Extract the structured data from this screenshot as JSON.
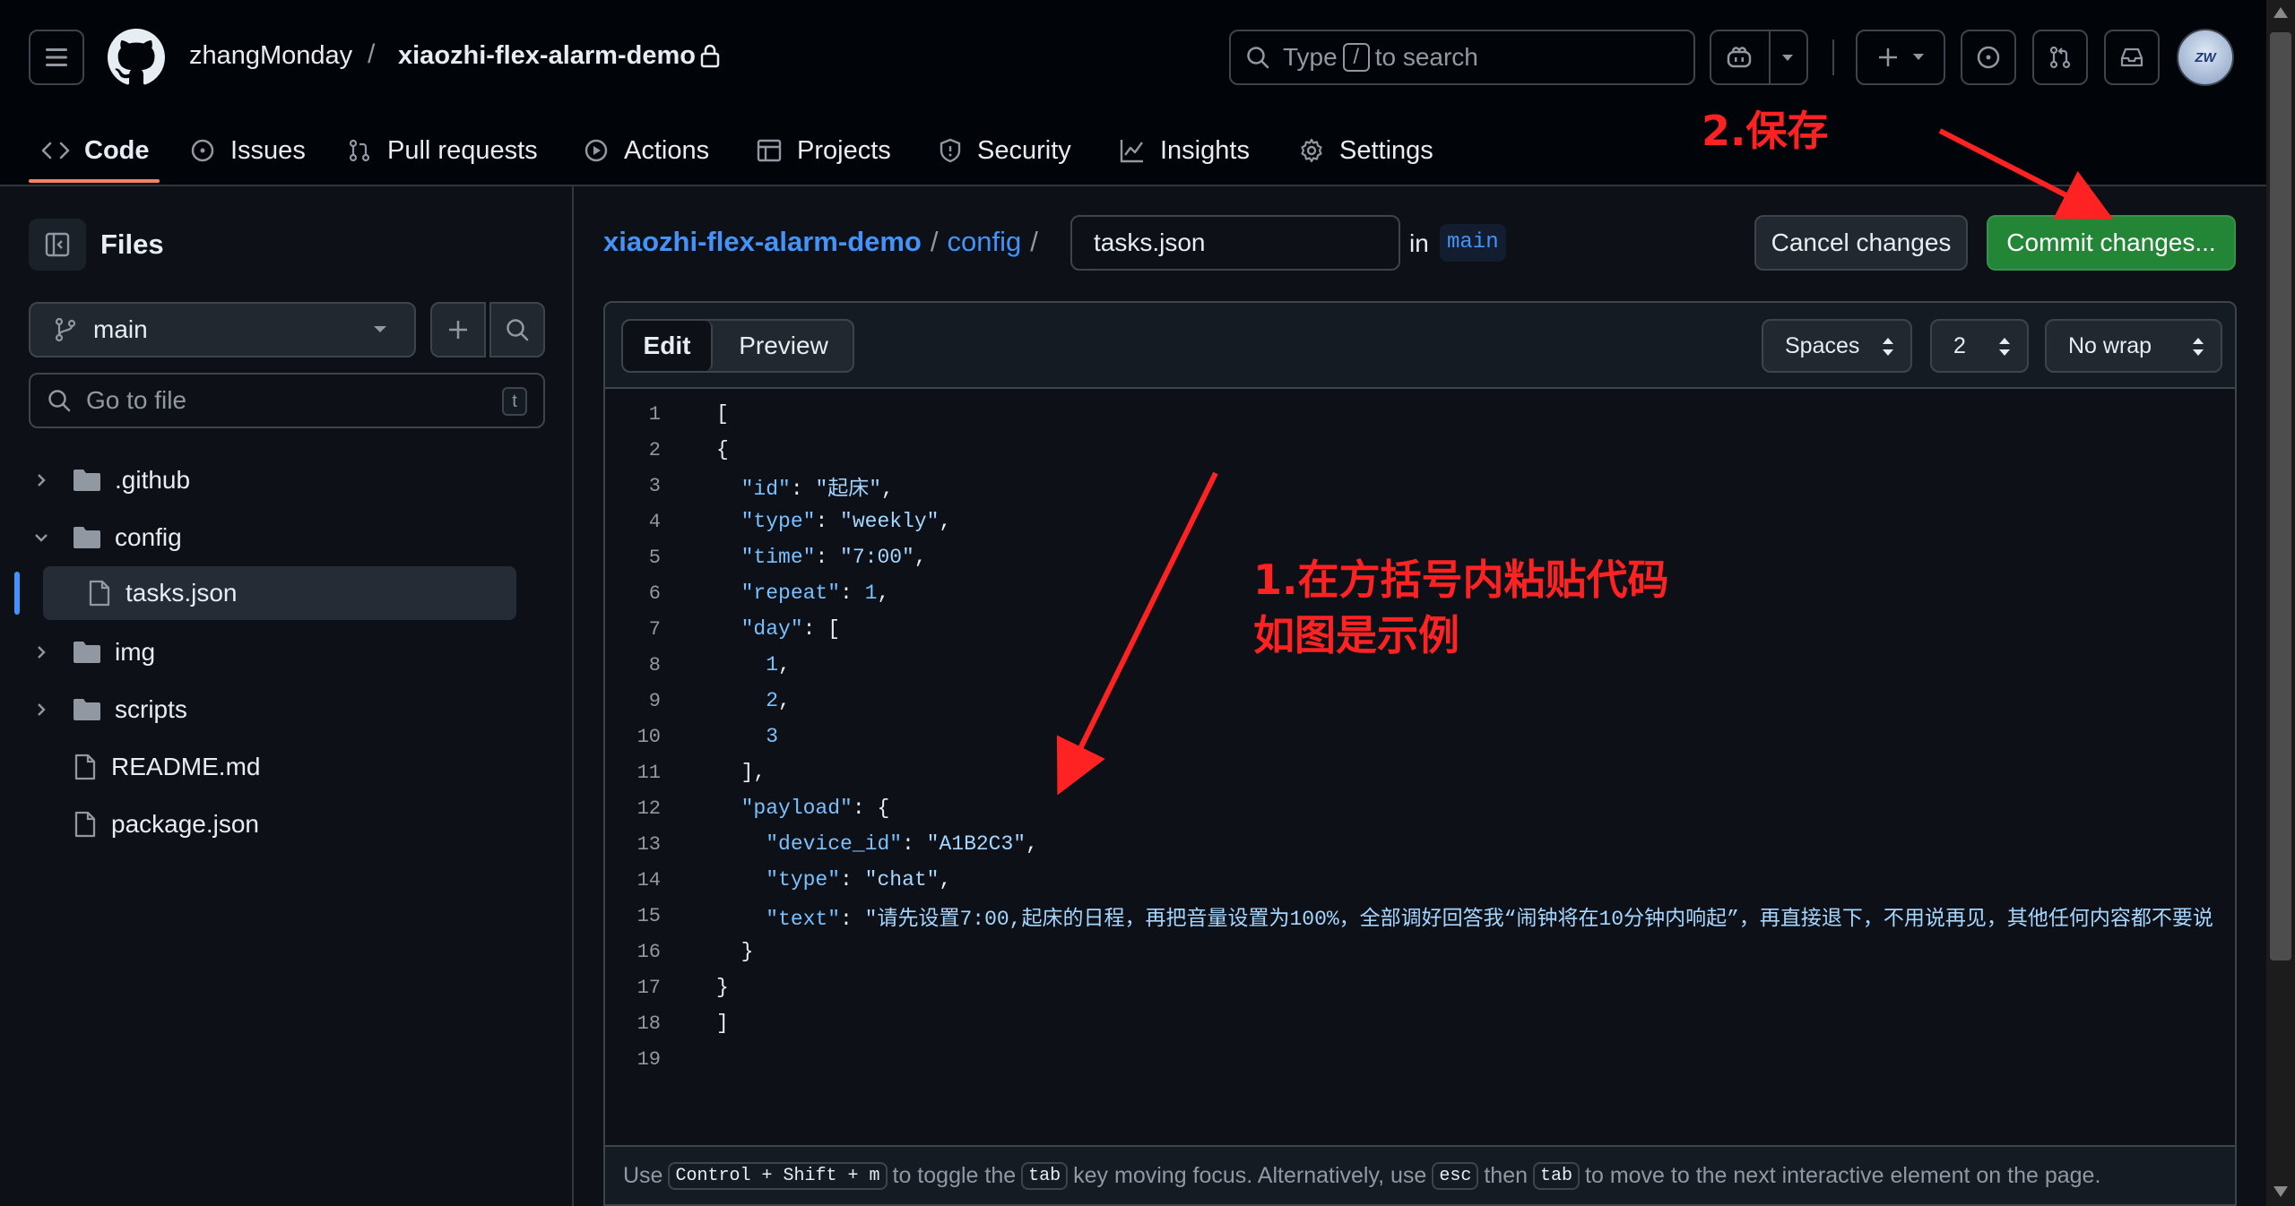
{
  "header": {
    "owner": "zhangMonday",
    "separator": "/",
    "repo": "xiaozhi-flex-alarm-demo",
    "search": {
      "prefix": "Type",
      "key": "/",
      "suffix": "to search"
    },
    "avatar_text": "ZW"
  },
  "tabs": [
    {
      "label": "Code",
      "icon": "code-icon"
    },
    {
      "label": "Issues",
      "icon": "issue-icon"
    },
    {
      "label": "Pull requests",
      "icon": "pull-request-icon"
    },
    {
      "label": "Actions",
      "icon": "play-icon"
    },
    {
      "label": "Projects",
      "icon": "table-icon"
    },
    {
      "label": "Security",
      "icon": "shield-icon"
    },
    {
      "label": "Insights",
      "icon": "graph-icon"
    },
    {
      "label": "Settings",
      "icon": "gear-icon"
    }
  ],
  "sidebar": {
    "title": "Files",
    "branch": "main",
    "goto_placeholder": "Go to file",
    "goto_kbd": "t",
    "tree": [
      {
        "name": ".github",
        "type": "folder",
        "expanded": false
      },
      {
        "name": "config",
        "type": "folder",
        "expanded": true
      },
      {
        "name": "tasks.json",
        "type": "file",
        "selected": true
      },
      {
        "name": "img",
        "type": "folder",
        "expanded": false
      },
      {
        "name": "scripts",
        "type": "folder",
        "expanded": false
      },
      {
        "name": "README.md",
        "type": "file"
      },
      {
        "name": "package.json",
        "type": "file"
      }
    ]
  },
  "breadcrumb": {
    "repo": "xiaozhi-flex-alarm-demo",
    "sep": "/",
    "folder": "config",
    "filename": "tasks.json",
    "in_label": "in",
    "branch": "main"
  },
  "actions": {
    "cancel": "Cancel changes",
    "commit": "Commit changes..."
  },
  "editor": {
    "edit_tab": "Edit",
    "preview_tab": "Preview",
    "indent_mode": "Spaces",
    "indent_size": "2",
    "wrap_mode": "No wrap",
    "lines": [
      "[",
      "{",
      "  \"id\": \"起床\",",
      "  \"type\": \"weekly\",",
      "  \"time\": \"7:00\",",
      "  \"repeat\": 1,",
      "  \"day\": [",
      "    1,",
      "    2,",
      "    3",
      "  ],",
      "  \"payload\": {",
      "    \"device_id\": \"A1B2C3\",",
      "    \"type\": \"chat\",",
      "    \"text\": \"请先设置7:00,起床的日程，再把音量设置为100%，全部调好回答我“闹钟将在10分钟内响起”，再直接退下，不用说再见，其他任何内容都不要说",
      "  }",
      "}",
      "]",
      ""
    ],
    "footer": {
      "t1": "Use",
      "k1": "Control + Shift + m",
      "t2": "to toggle the",
      "k2": "tab",
      "t3": "key moving focus. Alternatively, use",
      "k3": "esc",
      "t4": "then",
      "k4": "tab",
      "t5": "to move to the next interactive element on the page."
    }
  },
  "annotations": {
    "note1_line1": "1.在方括号内粘贴代码",
    "note1_line2": "如图是示例",
    "note2": "2.保存"
  },
  "colors": {
    "background": "#0d1117",
    "accent_link": "#4493f8",
    "commit_green": "#238636",
    "tab_underline": "#f78166",
    "annotation_red": "#ff2222"
  }
}
